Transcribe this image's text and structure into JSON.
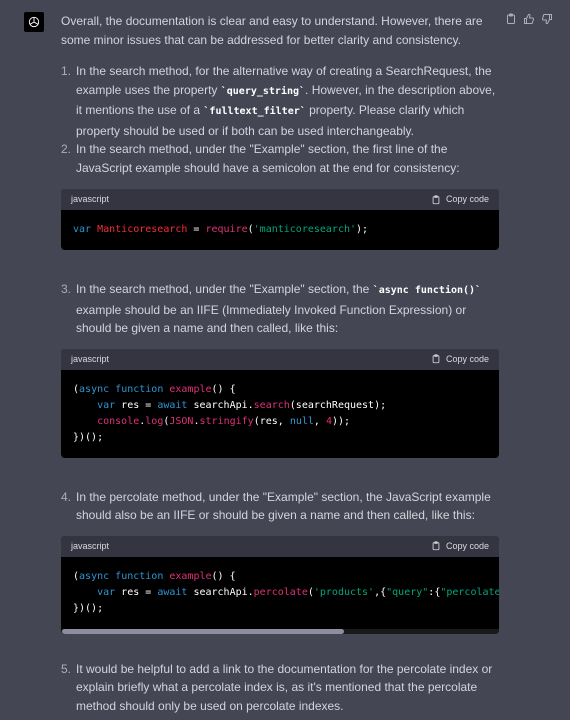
{
  "intro": "Overall, the documentation is clear and easy to understand. However, there are some minor issues that can be addressed for better clarity and consistency.",
  "items": [
    {
      "num": "1.",
      "parts": [
        "In the search method, for the alternative way of creating a SearchRequest, the example uses the property ",
        "`query_string`",
        ". However, in the description above, it mentions the use of a ",
        "`fulltext_filter`",
        " property. Please clarify which property should be used or if both can be used interchangeably."
      ]
    },
    {
      "num": "2.",
      "text": "In the search method, under the \"Example\" section, the first line of the JavaScript example should have a semicolon at the end for consistency:"
    },
    {
      "num": "3.",
      "pre": "In the search method, under the \"Example\" section, the ",
      "code": "`async function()`",
      "post": " example should be an IIFE (Immediately Invoked Function Expression) or should be given a name and then called, like this:"
    },
    {
      "num": "4.",
      "text": "In the percolate method, under the \"Example\" section, the JavaScript example should also be an IIFE or should be given a name and then called, like this:"
    },
    {
      "num": "5.",
      "text": "It would be helpful to add a link to the documentation for the percolate index or explain briefly what a percolate index is, as it's mentioned that the percolate method should only be used on percolate indexes."
    }
  ],
  "code_lang": "javascript",
  "copy_label": "Copy code",
  "code1": "var Manticoresearch = require('manticoresearch');",
  "code2": [
    "(async function example() {",
    "    var res = await searchApi.search(searchRequest);",
    "    console.log(JSON.stringify(res, null, 4));",
    "})();"
  ],
  "code3": [
    "(async function example() {",
    "    var res = await searchApi.percolate('products',{\"query\":{\"percolate\":{\"d",
    "})();"
  ],
  "icons": [
    "openai-logo-icon",
    "clipboard-icon",
    "thumbs-up-icon",
    "thumbs-down-icon",
    "copy-icon"
  ]
}
